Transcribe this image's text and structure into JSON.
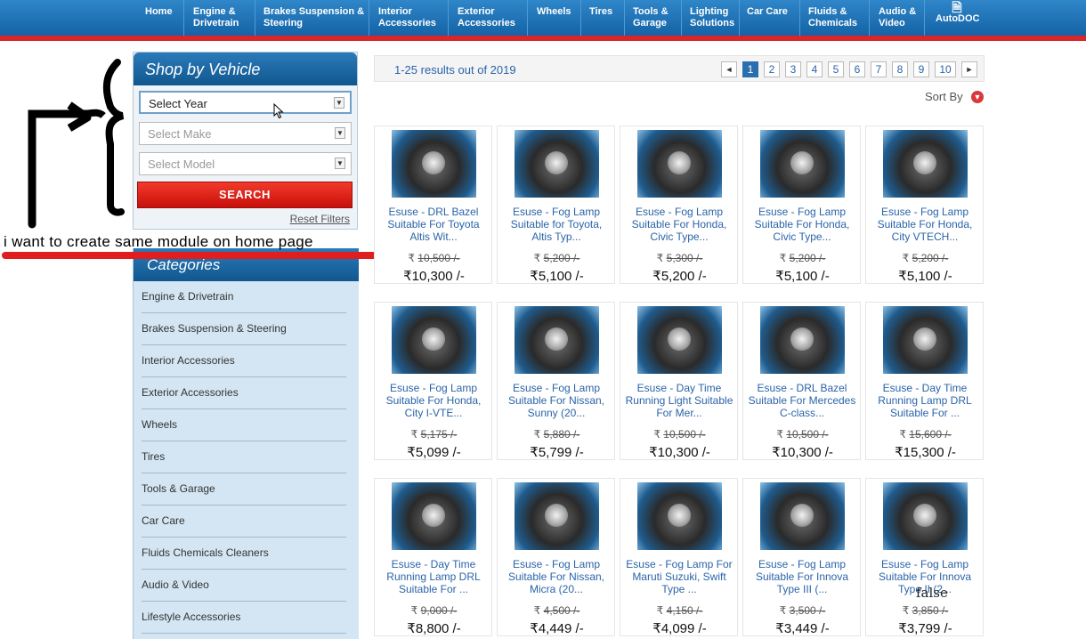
{
  "nav": {
    "items": [
      {
        "label": "Home"
      },
      {
        "label": "Engine & Drivetrain"
      },
      {
        "label": "Brakes Suspension & Steering"
      },
      {
        "label": "Interior Accessories"
      },
      {
        "label": "Exterior Accessories"
      },
      {
        "label": "Wheels"
      },
      {
        "label": "Tires"
      },
      {
        "label": "Tools & Garage"
      },
      {
        "label": "Lighting Solutions"
      },
      {
        "label": "Car Care"
      },
      {
        "label": "Fluids & Chemicals"
      },
      {
        "label": "Audio & Video"
      },
      {
        "label": "AutoDOC",
        "icon": "document-icon"
      }
    ]
  },
  "vehicle": {
    "title": "Shop by Vehicle",
    "year": "Select Year",
    "make": "Select Make",
    "model": "Select Model",
    "search": "SEARCH",
    "reset": "Reset Filters"
  },
  "annotation": {
    "text": "i want to create same module on home page"
  },
  "categories": {
    "title": "Categories",
    "items": [
      "Engine & Drivetrain",
      "Brakes Suspension & Steering",
      "Interior Accessories",
      "Exterior Accessories",
      "Wheels",
      "Tires",
      "Tools & Garage",
      "Car Care",
      "Fluids Chemicals Cleaners",
      "Audio & Video",
      "Lifestyle Accessories"
    ]
  },
  "results": {
    "count": "1-25 results out of 2019",
    "prev": "◄",
    "next": "►",
    "pages": [
      "1",
      "2",
      "3",
      "4",
      "5",
      "6",
      "7",
      "8",
      "9",
      "10"
    ],
    "sort_label": "Sort By"
  },
  "currency": "₹",
  "products": [
    {
      "name": "Esuse - DRL Bazel Suitable For Toyota Altis Wit...",
      "old": "10,500 /-",
      "new": "10,300 /-"
    },
    {
      "name": "Esuse - Fog Lamp Suitable for Toyota, Altis Typ...",
      "old": "5,200 /-",
      "new": "5,100 /-"
    },
    {
      "name": "Esuse - Fog Lamp Suitable For Honda, Civic Type...",
      "old": "5,300 /-",
      "new": "5,200 /-"
    },
    {
      "name": "Esuse - Fog Lamp Suitable For Honda, Civic Type...",
      "old": "5,200 /-",
      "new": "5,100 /-"
    },
    {
      "name": "Esuse - Fog Lamp Suitable For Honda, City VTECH...",
      "old": "5,200 /-",
      "new": "5,100 /-"
    },
    {
      "name": "Esuse - Fog Lamp Suitable For Honda, City I-VTE...",
      "old": "5,175 /-",
      "new": "5,099 /-"
    },
    {
      "name": "Esuse - Fog Lamp Suitable For Nissan, Sunny (20...",
      "old": "5,880 /-",
      "new": "5,799 /-"
    },
    {
      "name": "Esuse - Day Time Running Light Suitable For Mer...",
      "old": "10,500 /-",
      "new": "10,300 /-"
    },
    {
      "name": "Esuse - DRL Bazel Suitable For Mercedes C-class...",
      "old": "10,500 /-",
      "new": "10,300 /-"
    },
    {
      "name": "Esuse - Day Time Running Lamp DRL Suitable For ...",
      "old": "15,600 /-",
      "new": "15,300 /-"
    },
    {
      "name": "Esuse - Day Time Running Lamp DRL Suitable For ...",
      "old": "9,000 /-",
      "new": "8,800 /-"
    },
    {
      "name": "Esuse - Fog Lamp Suitable For Nissan, Micra (20...",
      "old": "4,500 /-",
      "new": "4,449 /-"
    },
    {
      "name": "Esuse - Fog Lamp For Maruti Suzuki, Swift Type ...",
      "old": "4,150 /-",
      "new": "4,099 /-"
    },
    {
      "name": "Esuse - Fog Lamp Suitable For Innova Type III (...",
      "old": "3,500 /-",
      "new": "3,449 /-"
    },
    {
      "name": "Esuse - Fog Lamp Suitable For Innova Type II (2...",
      "old": "3,850 /-",
      "new": "3,799 /-"
    }
  ],
  "overlay_text": "false"
}
